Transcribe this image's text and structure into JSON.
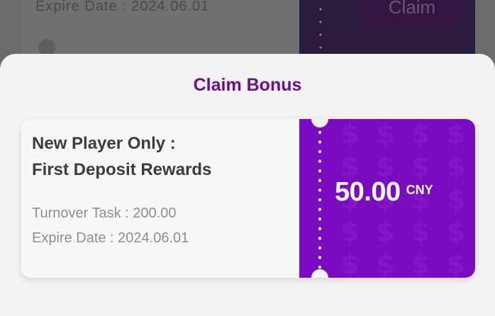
{
  "background": {
    "expire_text": "Expire Date :  2024.06.01",
    "claim_label": "Claim"
  },
  "sheet": {
    "title": "Claim Bonus"
  },
  "coupon": {
    "heading_line1": "New Player Only :",
    "heading_line2": "First Deposit Rewards",
    "turnover": "Turnover Task : 200.00",
    "expire": "Expire Date :  2024.06.01",
    "amount": "50.00",
    "currency": "CNY",
    "colors": {
      "accent": "#7a0bc0",
      "title": "#6f0d8f"
    }
  }
}
